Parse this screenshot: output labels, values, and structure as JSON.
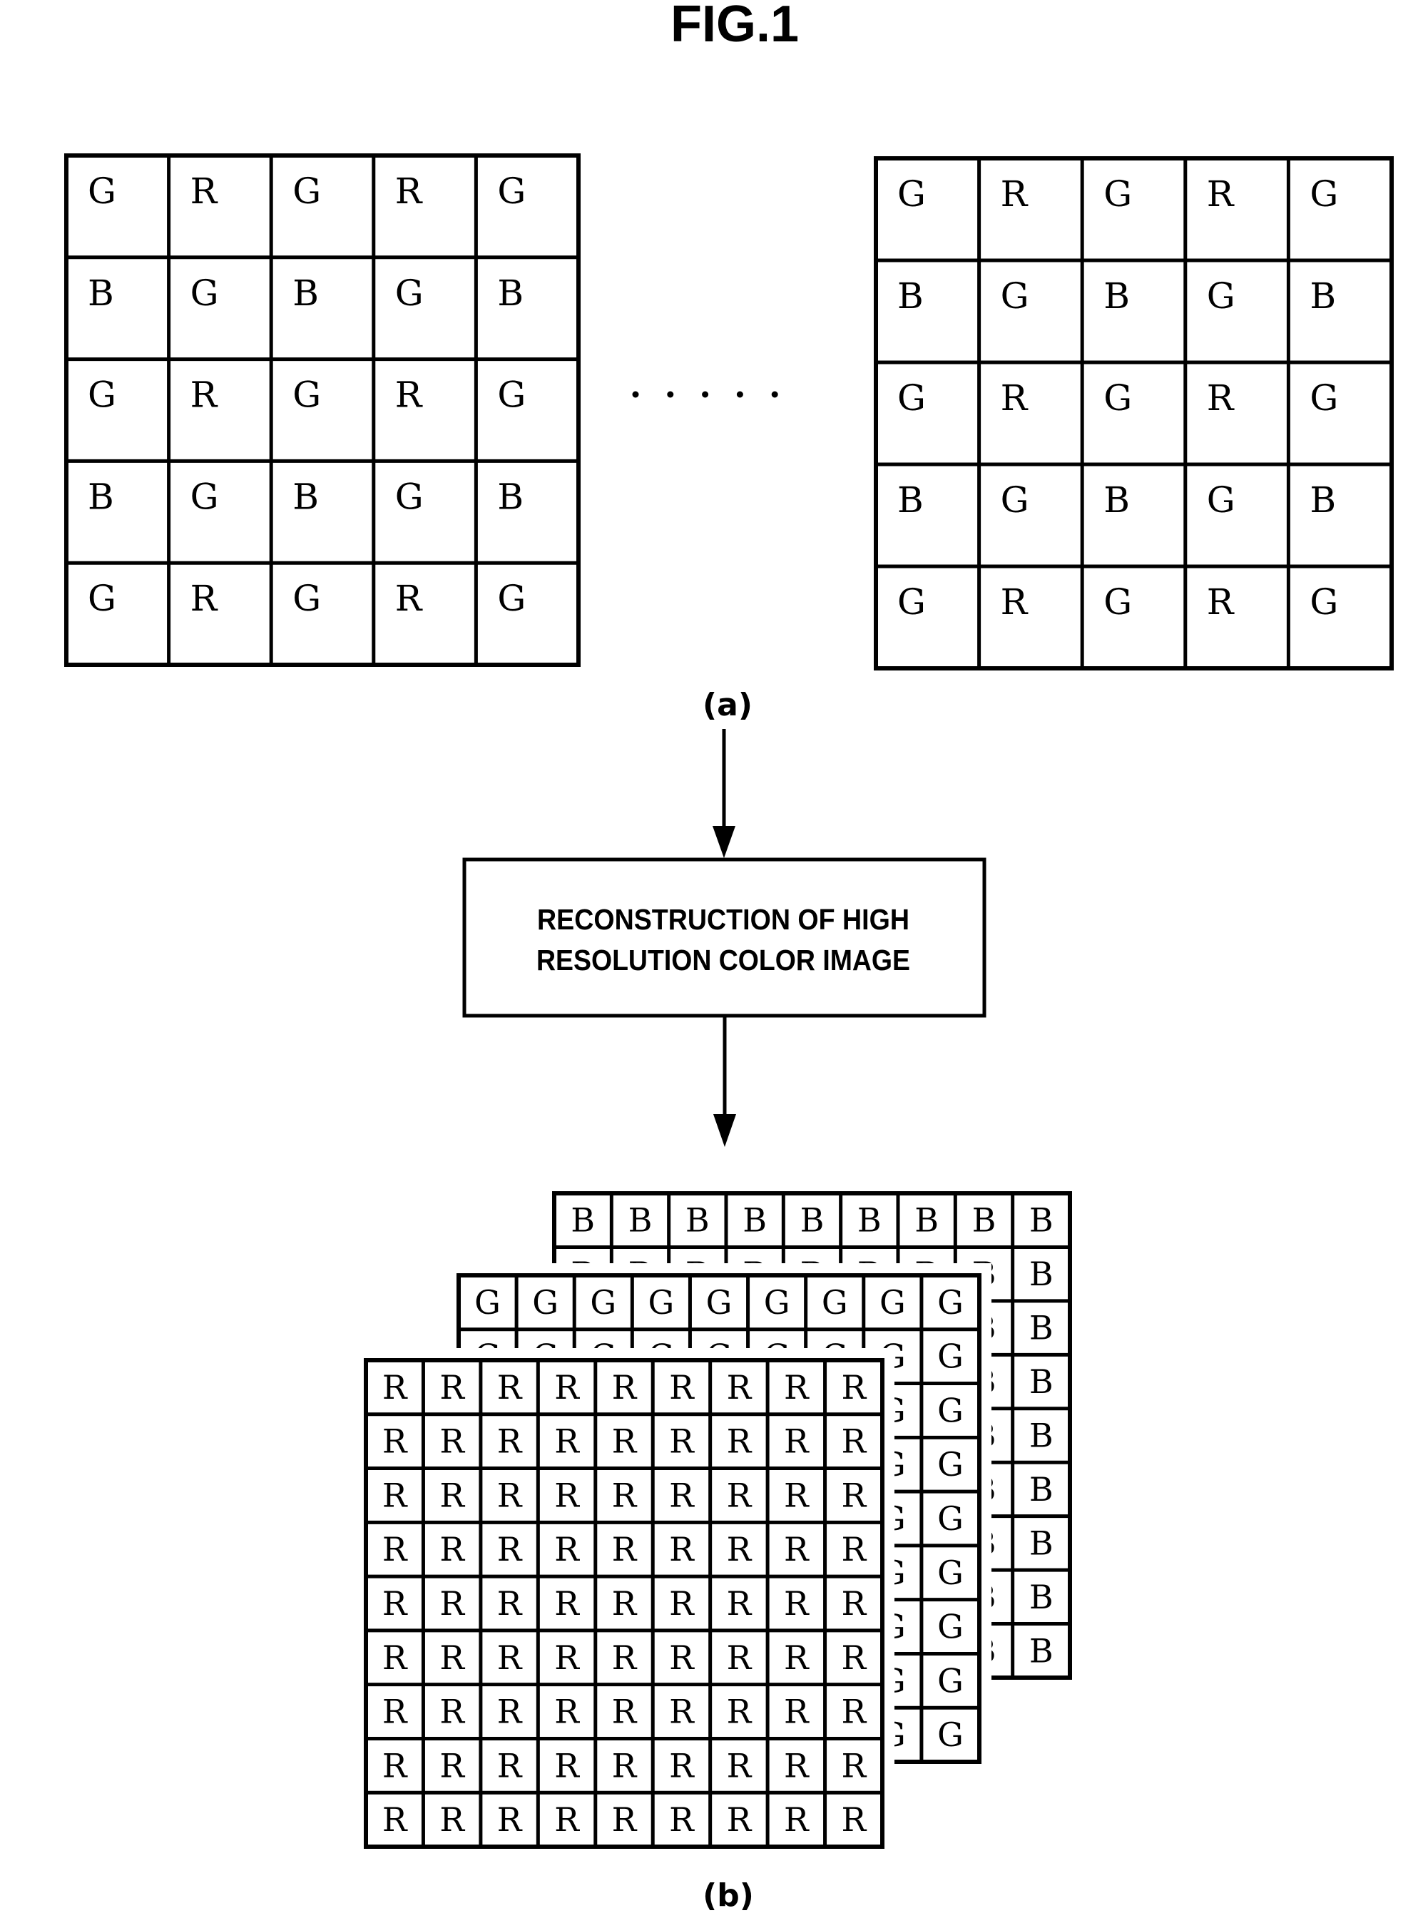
{
  "figure": {
    "title": "FIG.1",
    "ink_color": "#000000",
    "paper_color": "#ffffff"
  },
  "input_frames": {
    "label": "(a)",
    "ellipsis": ".....",
    "frames": [
      {
        "name": "first-frame",
        "rows": [
          [
            "G",
            "R",
            "G",
            "R",
            "G"
          ],
          [
            "B",
            "G",
            "B",
            "G",
            "B"
          ],
          [
            "G",
            "R",
            "G",
            "R",
            "G"
          ],
          [
            "B",
            "G",
            "B",
            "G",
            "B"
          ],
          [
            "G",
            "R",
            "G",
            "R",
            "G"
          ]
        ]
      },
      {
        "name": "last-frame",
        "rows": [
          [
            "G",
            "R",
            "G",
            "R",
            "G"
          ],
          [
            "B",
            "G",
            "B",
            "G",
            "B"
          ],
          [
            "G",
            "R",
            "G",
            "R",
            "G"
          ],
          [
            "B",
            "G",
            "B",
            "G",
            "B"
          ],
          [
            "G",
            "R",
            "G",
            "R",
            "G"
          ]
        ]
      }
    ]
  },
  "process": {
    "lines": [
      "RECONSTRUCTION OF HIGH",
      "RESOLUTION COLOR IMAGE"
    ]
  },
  "output_planes": {
    "label": "(b)",
    "planes": [
      {
        "name": "blue-plane",
        "letter": "B",
        "rows": 9,
        "cols": 9,
        "order": "back"
      },
      {
        "name": "green-plane",
        "letter": "G",
        "rows": 9,
        "cols": 9,
        "order": "middle"
      },
      {
        "name": "red-plane",
        "letter": "R",
        "rows": 9,
        "cols": 9,
        "order": "front"
      }
    ]
  }
}
